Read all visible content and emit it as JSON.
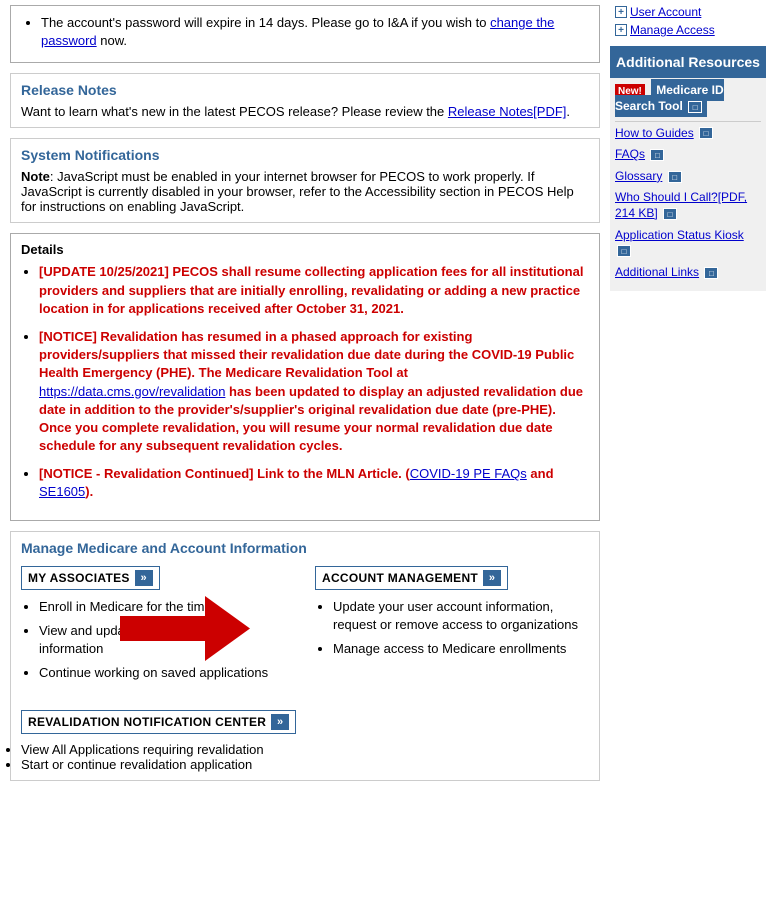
{
  "info": {
    "password_notice": "The account's password will expire in 14 days. Please go to I&A if you wish to",
    "change_link": "change the password",
    "password_suffix": "now."
  },
  "release_notes": {
    "title": "Release Notes",
    "text": "Want to learn what's new in the latest PECOS release? Please review the",
    "link_text": "Release Notes[PDF]",
    "period": "."
  },
  "system_notifications": {
    "title": "System Notifications",
    "note_label": "Note",
    "note_text": ": JavaScript must be enabled in your internet browser for PECOS to work properly. If JavaScript is currently disabled in your browser, refer to the Accessibility section in PECOS Help for instructions on enabling JavaScript."
  },
  "details": {
    "title": "Details",
    "items": [
      "[UPDATE 10/25/2021] PECOS shall resume collecting application fees for all institutional providers and suppliers that are initially enrolling, revalidating or adding a new practice location in for applications received after October 31, 2021.",
      "[NOTICE] Revalidation has resumed in a phased approach for existing providers/suppliers that missed their revalidation due date during the COVID-19 Public Health Emergency (PHE). The Medicare Revalidation Tool at https://data.cms.gov/revalidation has been updated to display an adjusted revalidation due date in addition to the provider's/supplier's original revalidation due date (pre-PHE). Once you complete revalidation, you will resume your normal revalidation due date schedule for any subsequent revalidation cycles.",
      "[NOTICE - Revalidation Continued] Link to the MLN Article."
    ],
    "covid_link": "COVID-19 PE FAQs",
    "se_link": "SE1605",
    "revalidation_link": "https://data.cms.gov/revalidation"
  },
  "manage": {
    "title": "Manage Medicare and Account Information",
    "my_associates": {
      "label": "MY ASSOCIATES",
      "items": [
        "Enroll in Medicare for the time",
        "View and update existing Medicare information",
        "Continue working on saved applications"
      ]
    },
    "account_management": {
      "label": "ACCOUNT MANAGEMENT",
      "items": [
        "Update your user account information, request or remove access to organizations",
        "Manage access to Medicare enrollments"
      ]
    },
    "revalidation": {
      "label": "REVALIDATION NOTIFICATION CENTER",
      "items": [
        "View All Applications requiring revalidation",
        "Start or continue revalidation application"
      ]
    }
  },
  "sidebar": {
    "top_links": [
      "User Account",
      "Manage Access"
    ],
    "additional_resources": "Additional Resources",
    "medicare_tool": {
      "new_label": "New!",
      "title": "Medicare ID Search Tool"
    },
    "links": [
      {
        "text": "How to Guides",
        "has_icon": true
      },
      {
        "text": "FAQs",
        "has_icon": true
      },
      {
        "text": "Glossary",
        "has_icon": true
      },
      {
        "text": "Who Should I Call?[PDF, 214 KB]",
        "has_icon": true
      },
      {
        "text": "Application Status Kiosk",
        "has_icon": true
      },
      {
        "text": "Additional Links",
        "has_icon": true
      }
    ]
  },
  "colors": {
    "blue": "#336699",
    "red": "#cc0000",
    "link": "#0000cc"
  }
}
